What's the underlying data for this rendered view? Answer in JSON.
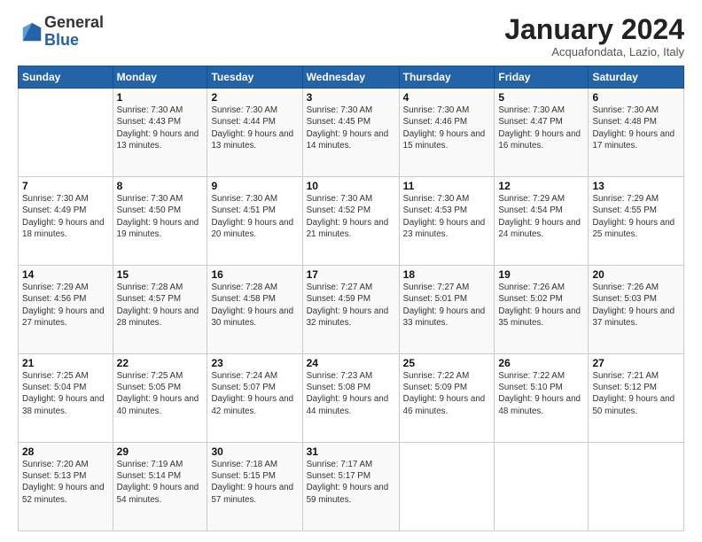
{
  "logo": {
    "general": "General",
    "blue": "Blue"
  },
  "header": {
    "title": "January 2024",
    "location": "Acquafondata, Lazio, Italy"
  },
  "days_of_week": [
    "Sunday",
    "Monday",
    "Tuesday",
    "Wednesday",
    "Thursday",
    "Friday",
    "Saturday"
  ],
  "weeks": [
    [
      {
        "day": "",
        "sunrise": "",
        "sunset": "",
        "daylight": ""
      },
      {
        "day": "1",
        "sunrise": "Sunrise: 7:30 AM",
        "sunset": "Sunset: 4:43 PM",
        "daylight": "Daylight: 9 hours and 13 minutes."
      },
      {
        "day": "2",
        "sunrise": "Sunrise: 7:30 AM",
        "sunset": "Sunset: 4:44 PM",
        "daylight": "Daylight: 9 hours and 13 minutes."
      },
      {
        "day": "3",
        "sunrise": "Sunrise: 7:30 AM",
        "sunset": "Sunset: 4:45 PM",
        "daylight": "Daylight: 9 hours and 14 minutes."
      },
      {
        "day": "4",
        "sunrise": "Sunrise: 7:30 AM",
        "sunset": "Sunset: 4:46 PM",
        "daylight": "Daylight: 9 hours and 15 minutes."
      },
      {
        "day": "5",
        "sunrise": "Sunrise: 7:30 AM",
        "sunset": "Sunset: 4:47 PM",
        "daylight": "Daylight: 9 hours and 16 minutes."
      },
      {
        "day": "6",
        "sunrise": "Sunrise: 7:30 AM",
        "sunset": "Sunset: 4:48 PM",
        "daylight": "Daylight: 9 hours and 17 minutes."
      }
    ],
    [
      {
        "day": "7",
        "sunrise": "Sunrise: 7:30 AM",
        "sunset": "Sunset: 4:49 PM",
        "daylight": "Daylight: 9 hours and 18 minutes."
      },
      {
        "day": "8",
        "sunrise": "Sunrise: 7:30 AM",
        "sunset": "Sunset: 4:50 PM",
        "daylight": "Daylight: 9 hours and 19 minutes."
      },
      {
        "day": "9",
        "sunrise": "Sunrise: 7:30 AM",
        "sunset": "Sunset: 4:51 PM",
        "daylight": "Daylight: 9 hours and 20 minutes."
      },
      {
        "day": "10",
        "sunrise": "Sunrise: 7:30 AM",
        "sunset": "Sunset: 4:52 PM",
        "daylight": "Daylight: 9 hours and 21 minutes."
      },
      {
        "day": "11",
        "sunrise": "Sunrise: 7:30 AM",
        "sunset": "Sunset: 4:53 PM",
        "daylight": "Daylight: 9 hours and 23 minutes."
      },
      {
        "day": "12",
        "sunrise": "Sunrise: 7:29 AM",
        "sunset": "Sunset: 4:54 PM",
        "daylight": "Daylight: 9 hours and 24 minutes."
      },
      {
        "day": "13",
        "sunrise": "Sunrise: 7:29 AM",
        "sunset": "Sunset: 4:55 PM",
        "daylight": "Daylight: 9 hours and 25 minutes."
      }
    ],
    [
      {
        "day": "14",
        "sunrise": "Sunrise: 7:29 AM",
        "sunset": "Sunset: 4:56 PM",
        "daylight": "Daylight: 9 hours and 27 minutes."
      },
      {
        "day": "15",
        "sunrise": "Sunrise: 7:28 AM",
        "sunset": "Sunset: 4:57 PM",
        "daylight": "Daylight: 9 hours and 28 minutes."
      },
      {
        "day": "16",
        "sunrise": "Sunrise: 7:28 AM",
        "sunset": "Sunset: 4:58 PM",
        "daylight": "Daylight: 9 hours and 30 minutes."
      },
      {
        "day": "17",
        "sunrise": "Sunrise: 7:27 AM",
        "sunset": "Sunset: 4:59 PM",
        "daylight": "Daylight: 9 hours and 32 minutes."
      },
      {
        "day": "18",
        "sunrise": "Sunrise: 7:27 AM",
        "sunset": "Sunset: 5:01 PM",
        "daylight": "Daylight: 9 hours and 33 minutes."
      },
      {
        "day": "19",
        "sunrise": "Sunrise: 7:26 AM",
        "sunset": "Sunset: 5:02 PM",
        "daylight": "Daylight: 9 hours and 35 minutes."
      },
      {
        "day": "20",
        "sunrise": "Sunrise: 7:26 AM",
        "sunset": "Sunset: 5:03 PM",
        "daylight": "Daylight: 9 hours and 37 minutes."
      }
    ],
    [
      {
        "day": "21",
        "sunrise": "Sunrise: 7:25 AM",
        "sunset": "Sunset: 5:04 PM",
        "daylight": "Daylight: 9 hours and 38 minutes."
      },
      {
        "day": "22",
        "sunrise": "Sunrise: 7:25 AM",
        "sunset": "Sunset: 5:05 PM",
        "daylight": "Daylight: 9 hours and 40 minutes."
      },
      {
        "day": "23",
        "sunrise": "Sunrise: 7:24 AM",
        "sunset": "Sunset: 5:07 PM",
        "daylight": "Daylight: 9 hours and 42 minutes."
      },
      {
        "day": "24",
        "sunrise": "Sunrise: 7:23 AM",
        "sunset": "Sunset: 5:08 PM",
        "daylight": "Daylight: 9 hours and 44 minutes."
      },
      {
        "day": "25",
        "sunrise": "Sunrise: 7:22 AM",
        "sunset": "Sunset: 5:09 PM",
        "daylight": "Daylight: 9 hours and 46 minutes."
      },
      {
        "day": "26",
        "sunrise": "Sunrise: 7:22 AM",
        "sunset": "Sunset: 5:10 PM",
        "daylight": "Daylight: 9 hours and 48 minutes."
      },
      {
        "day": "27",
        "sunrise": "Sunrise: 7:21 AM",
        "sunset": "Sunset: 5:12 PM",
        "daylight": "Daylight: 9 hours and 50 minutes."
      }
    ],
    [
      {
        "day": "28",
        "sunrise": "Sunrise: 7:20 AM",
        "sunset": "Sunset: 5:13 PM",
        "daylight": "Daylight: 9 hours and 52 minutes."
      },
      {
        "day": "29",
        "sunrise": "Sunrise: 7:19 AM",
        "sunset": "Sunset: 5:14 PM",
        "daylight": "Daylight: 9 hours and 54 minutes."
      },
      {
        "day": "30",
        "sunrise": "Sunrise: 7:18 AM",
        "sunset": "Sunset: 5:15 PM",
        "daylight": "Daylight: 9 hours and 57 minutes."
      },
      {
        "day": "31",
        "sunrise": "Sunrise: 7:17 AM",
        "sunset": "Sunset: 5:17 PM",
        "daylight": "Daylight: 9 hours and 59 minutes."
      },
      {
        "day": "",
        "sunrise": "",
        "sunset": "",
        "daylight": ""
      },
      {
        "day": "",
        "sunrise": "",
        "sunset": "",
        "daylight": ""
      },
      {
        "day": "",
        "sunrise": "",
        "sunset": "",
        "daylight": ""
      }
    ]
  ]
}
